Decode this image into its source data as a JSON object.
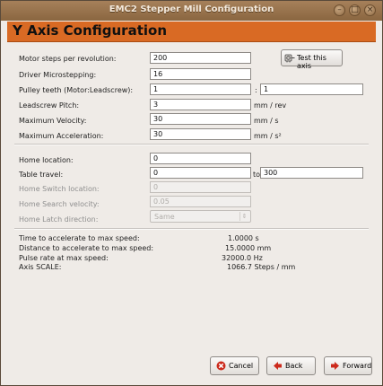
{
  "window": {
    "title": "EMC2 Stepper Mill Configuration"
  },
  "header": {
    "title": "Y Axis Configuration"
  },
  "motor": {
    "steps_label": "Motor steps per revolution:",
    "steps_value": "200",
    "microstep_label": "Driver Microstepping:",
    "microstep_value": "16",
    "pulley_label": "Pulley teeth (Motor:Leadscrew):",
    "pulley_motor": "1",
    "pulley_sep": ":",
    "pulley_leadscrew": "1",
    "pitch_label": "Leadscrew Pitch:",
    "pitch_value": "3",
    "pitch_unit": "mm / rev",
    "velocity_label": "Maximum Velocity:",
    "velocity_value": "30",
    "velocity_unit": "mm / s",
    "accel_label": "Maximum Acceleration:",
    "accel_value": "30",
    "accel_unit": "mm / s²",
    "test_button": "Test this axis"
  },
  "home": {
    "location_label": "Home location:",
    "location_value": "0",
    "travel_label": "Table travel:",
    "travel_min": "0",
    "travel_to": "to",
    "travel_max": "300",
    "switch_label": "Home Switch location:",
    "switch_value": "0",
    "search_label": "Home Search velocity:",
    "search_value": "0.05",
    "latch_label": "Home Latch direction:",
    "latch_value": "Same"
  },
  "info": {
    "time_label": "Time to accelerate to max speed:",
    "time_value": "1.0000 s",
    "dist_label": "Distance to accelerate to max speed:",
    "dist_value": "15.0000 mm",
    "pulse_label": "Pulse rate at max speed:",
    "pulse_value": "32000.0 Hz",
    "scale_label": "Axis SCALE:",
    "scale_value": "1066.7 Steps / mm"
  },
  "buttons": {
    "cancel": "Cancel",
    "back": "Back",
    "forward": "Forward"
  }
}
